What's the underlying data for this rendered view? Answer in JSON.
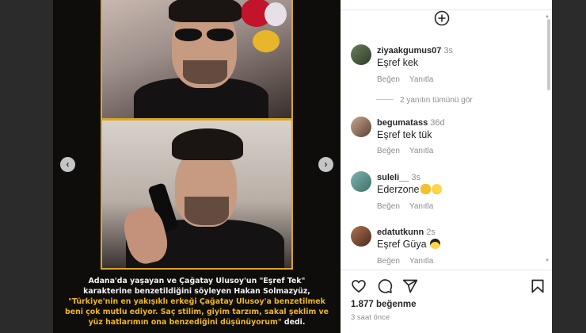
{
  "post": {
    "caption_line1": "Adana'da yaşayan ve Çağatay Ulusoy'un \"Eşref Tek\"",
    "caption_line2": "karakterine benzetildiğini söyleyen Hakan Solmazyüz,",
    "caption_quote1": "\"Türkiye'nin en yakışıklı erkeği Çağatay Ulusoy'a benzetilmek",
    "caption_quote2": "beni çok mutlu ediyor. Saç stilim, giyim tarzım, sakal şeklim ve",
    "caption_quote3": "yüz hatlarımın ona benzediğini düşünüyorum\"",
    "caption_tail": " dedi.",
    "accent_color": "#f0b61d",
    "border_color": "#d9a625"
  },
  "comments": [
    {
      "username": "ziyaakgumus07",
      "time": "3s",
      "text": "Eşref kek",
      "like_label": "Beğen",
      "reply_label": "Yanıtla"
    },
    {
      "username": "begumatass",
      "time": "36d",
      "text": "Eşref tek tük",
      "like_label": "Beğen",
      "reply_label": "Yanıtla"
    },
    {
      "username": "suleli__",
      "time": "3s",
      "text": "Ederzone",
      "like_label": "Beğen",
      "reply_label": "Yanıtla",
      "emojis": [
        "clapping-hands-emoji",
        "grinning-face-emoji"
      ]
    },
    {
      "username": "edatutkunn",
      "time": "2s",
      "text": "Eşref Güya",
      "like_label": "Beğen",
      "reply_label": "Yanıtla",
      "emojis": [
        "sunglasses-face-emoji"
      ]
    }
  ],
  "view_replies": "2 yanıtın tümünü gör",
  "stats": {
    "likes_count": "1.877",
    "likes_label": "beğenme",
    "posted_time": "3 saat önce"
  },
  "icons": [
    "add-circle-icon",
    "heart-icon",
    "comment-icon",
    "share-icon",
    "bookmark-icon",
    "prev-arrow-icon",
    "next-arrow-icon"
  ]
}
